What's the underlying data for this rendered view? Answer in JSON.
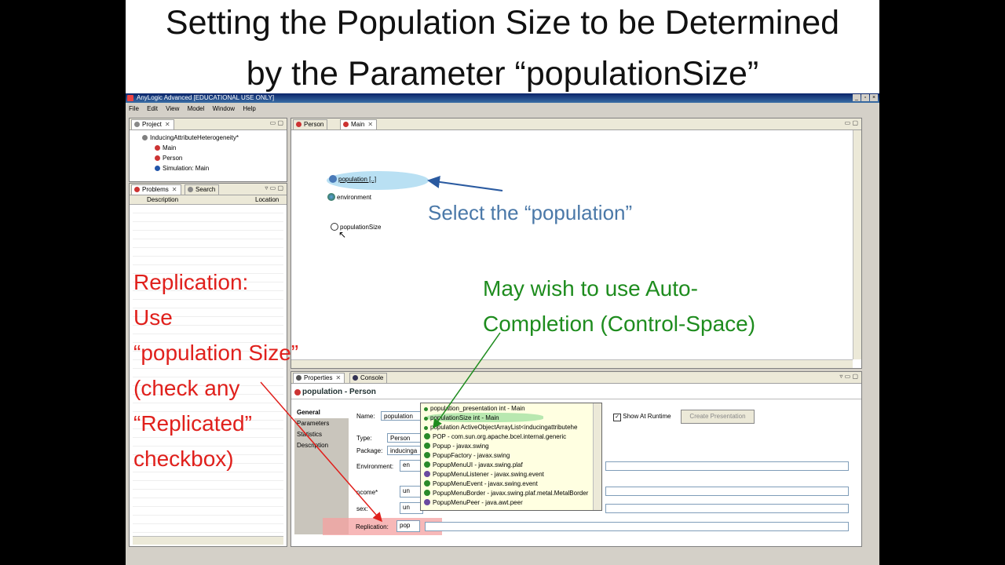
{
  "slide": {
    "title_line1": "Setting the Population Size to be Determined",
    "title_line2": "by the Parameter “populationSize”"
  },
  "window": {
    "title": "AnyLogic Advanced [EDUCATIONAL USE ONLY]",
    "controls": [
      "_",
      "▫",
      "×"
    ]
  },
  "menu": [
    "File",
    "Edit",
    "View",
    "Model",
    "Window",
    "Help"
  ],
  "project_panel": {
    "tab": "Project",
    "tree": [
      {
        "label": "InducingAttributeHeterogeneity*",
        "icon_color": "#808080"
      },
      {
        "label": "Main",
        "icon_color": "#cc3333"
      },
      {
        "label": "Person",
        "icon_color": "#cc3333"
      },
      {
        "label": "Simulation: Main",
        "icon_color": "#2255aa"
      }
    ]
  },
  "problems_panel": {
    "tabs": [
      "Problems",
      "Search"
    ],
    "columns": [
      "Description",
      "Location"
    ]
  },
  "editor": {
    "tabs": [
      "Person",
      "Main"
    ],
    "elements": {
      "population": "population [..]",
      "environment": "environment",
      "populationSize": "populationSize"
    }
  },
  "properties": {
    "tabs": [
      "Properties",
      "Console"
    ],
    "header": "population - Person",
    "side_tabs": [
      "General",
      "Parameters",
      "Statistics",
      "Description"
    ],
    "labels": {
      "name": "Name:",
      "type": "Type:",
      "package": "Package:",
      "environment": "Environment:",
      "income": "ncome*",
      "sex": "sex:",
      "replication": "Replication:"
    },
    "values": {
      "name": "population",
      "type": "Person",
      "package": "inducinga",
      "environment": "en",
      "income": "un",
      "sex": "un",
      "replication": "pop"
    },
    "show_at_runtime": "Show At Runtime",
    "create_presentation": "Create Presentation"
  },
  "autocomplete": [
    {
      "text": "population_presentation   int - Main",
      "color": "#2a8a2a"
    },
    {
      "text": "populationSize     int - Main",
      "color": "#2a8a2a"
    },
    {
      "text": "population    ActiveObjectArrayList<inducingattributehe",
      "color": "#2a8a2a"
    },
    {
      "text": "POP - com.sun.org.apache.bcel.internal.generic",
      "color": "#2a8a2a"
    },
    {
      "text": "Popup - javax.swing",
      "color": "#2a8a2a"
    },
    {
      "text": "PopupFactory - javax.swing",
      "color": "#2a8a2a"
    },
    {
      "text": "PopupMenuUI - javax.swing.plaf",
      "color": "#2a8a2a"
    },
    {
      "text": "PopupMenuListener - javax.swing.event",
      "color": "#6a4aa0"
    },
    {
      "text": "PopupMenuEvent - javax.swing.event",
      "color": "#2a8a2a"
    },
    {
      "text": "PopupMenuBorder - javax.swing.plaf.metal.MetalBorder",
      "color": "#2a8a2a"
    },
    {
      "text": "PopupMenuPeer - java.awt.peer",
      "color": "#6a4aa0"
    }
  ],
  "annotations": {
    "select": "Select the “population”",
    "autocomplete_1": "May wish to use Auto-",
    "autocomplete_2": "Completion (Control-Space)",
    "replication": [
      "Replication:",
      "Use",
      "“population Size”",
      "(check any",
      "“Replicated”",
      "checkbox)"
    ]
  },
  "colors": {
    "annotation_blue": "#4a78a8",
    "annotation_green": "#1e8c1e",
    "annotation_red": "#e0201c",
    "highlight_blue": "#a8d8f0",
    "highlight_green": "#b8e8b0",
    "highlight_red": "#f4a0a0"
  }
}
